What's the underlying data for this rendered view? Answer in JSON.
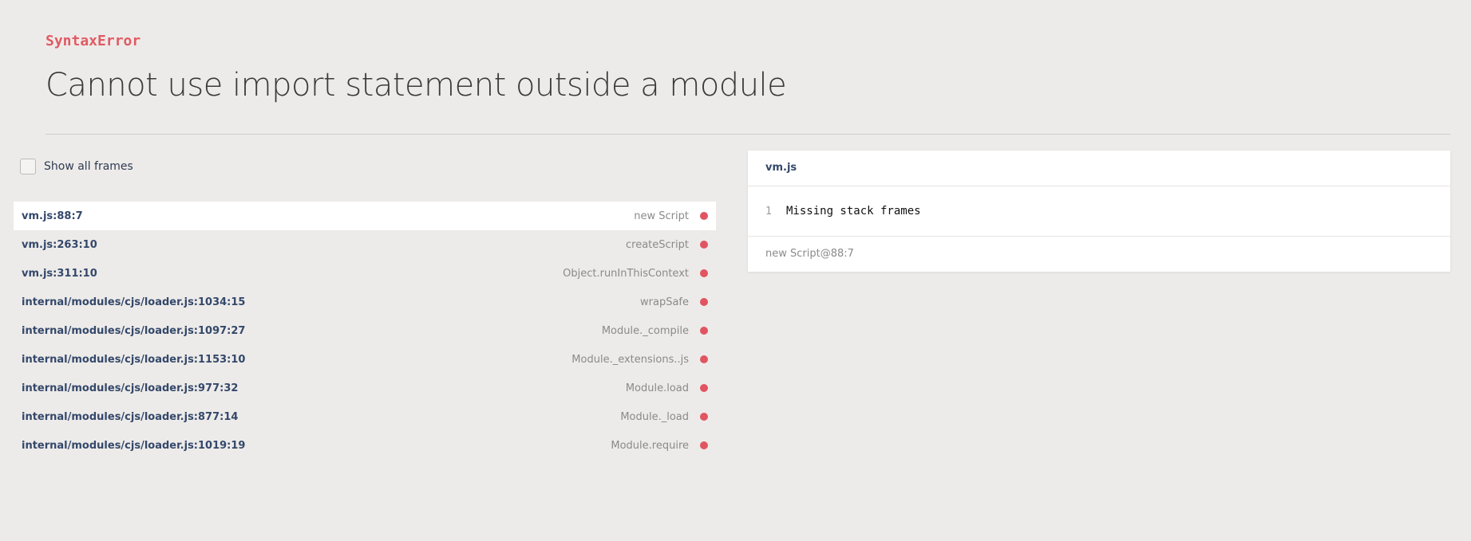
{
  "error": {
    "name": "SyntaxError",
    "message": "Cannot use import statement outside a module"
  },
  "frames_toggle": {
    "label": "Show all frames",
    "checked": false
  },
  "frames": [
    {
      "file": "vm.js:88:7",
      "method": "new Script",
      "active": true
    },
    {
      "file": "vm.js:263:10",
      "method": "createScript",
      "active": false
    },
    {
      "file": "vm.js:311:10",
      "method": "Object.runInThisContext",
      "active": false
    },
    {
      "file": "internal/modules/cjs/loader.js:1034:15",
      "method": "wrapSafe",
      "active": false
    },
    {
      "file": "internal/modules/cjs/loader.js:1097:27",
      "method": "Module._compile",
      "active": false
    },
    {
      "file": "internal/modules/cjs/loader.js:1153:10",
      "method": "Module._extensions..js",
      "active": false
    },
    {
      "file": "internal/modules/cjs/loader.js:977:32",
      "method": "Module.load",
      "active": false
    },
    {
      "file": "internal/modules/cjs/loader.js:877:14",
      "method": "Module._load",
      "active": false
    },
    {
      "file": "internal/modules/cjs/loader.js:1019:19",
      "method": "Module.require",
      "active": false
    }
  ],
  "code_panel": {
    "title": "vm.js",
    "line_number": "1",
    "line_text": "Missing stack frames",
    "footer": "new Script@88:7"
  },
  "colors": {
    "background": "#edebe9",
    "error_accent": "#e15a64",
    "frame_dot": "#e05561",
    "file_text": "#34486b"
  }
}
